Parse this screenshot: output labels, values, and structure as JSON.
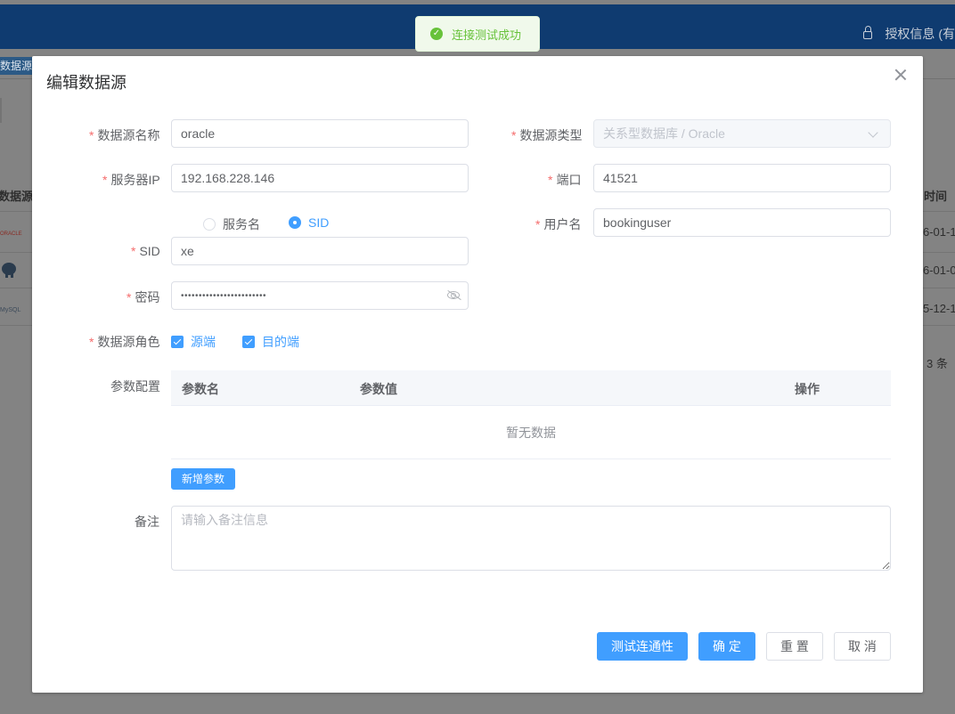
{
  "background": {
    "auth_label": "授权信息 (有",
    "tab_label": "数据源 ×",
    "left_header": "数据源",
    "right_header": "时间",
    "right_cells": [
      "6-01-1",
      "6-01-0",
      "5-12-1"
    ],
    "total_text": "3 条",
    "logo_names": [
      "oracle-logo",
      "postgresql-logo",
      "mysql-logo"
    ]
  },
  "toast": {
    "message": "连接测试成功",
    "icon": "check-circle-icon",
    "color": "#67c23a"
  },
  "dialog": {
    "title": "编辑数据源",
    "close_icon": "close-icon",
    "fields": {
      "name": {
        "label": "数据源名称",
        "value": "oracle",
        "required": true
      },
      "type": {
        "label": "数据源类型",
        "value": "关系型数据库 / Oracle",
        "required": true,
        "disabled": true
      },
      "server_ip": {
        "label": "服务器IP",
        "value": "192.168.228.146",
        "required": true
      },
      "port": {
        "label": "端口",
        "value": "41521",
        "required": true
      },
      "conn_mode": {
        "options": [
          "服务名",
          "SID"
        ],
        "selected": "SID"
      },
      "username": {
        "label": "用户名",
        "value": "bookinguser",
        "required": true
      },
      "sid": {
        "label": "SID",
        "value": "xe",
        "required": true
      },
      "password": {
        "label": "密码",
        "value": "••••••••••••••••••••••••",
        "required": true
      },
      "role": {
        "label": "数据源角色",
        "required": true,
        "options": [
          "源端",
          "目的端"
        ],
        "checked": [
          "源端",
          "目的端"
        ]
      },
      "params": {
        "label": "参数配置",
        "columns": [
          "参数名",
          "参数值",
          "操作"
        ],
        "empty_text": "暂无数据",
        "add_button": "新增参数"
      },
      "remark": {
        "label": "备注",
        "placeholder": "请输入备注信息",
        "value": ""
      }
    },
    "buttons": {
      "test": "测试连通性",
      "confirm": "确 定",
      "reset": "重 置",
      "cancel": "取 消"
    },
    "accent_color": "#409eff"
  }
}
